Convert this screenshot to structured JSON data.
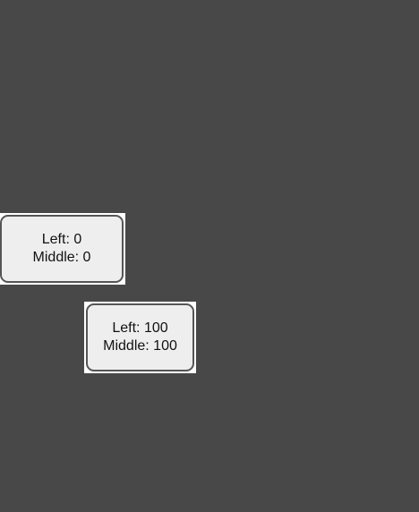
{
  "boxes": [
    {
      "line1": "Left: 0",
      "line2": "Middle: 0"
    },
    {
      "line1": "Left: 100",
      "line2": "Middle: 100"
    }
  ]
}
